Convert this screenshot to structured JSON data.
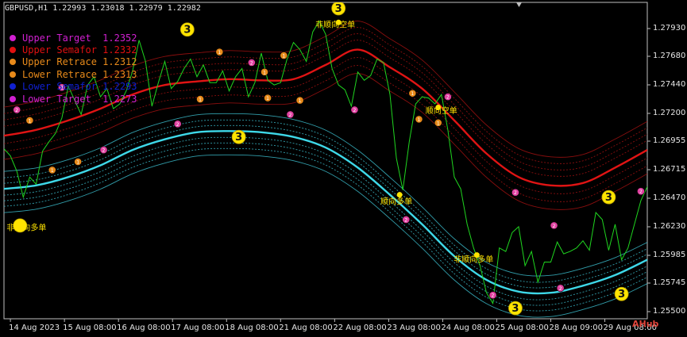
{
  "header": {
    "symbol": "GBPUSD,H1  1.22993 1.23018 1.22979 1.22982"
  },
  "legend": [
    {
      "label": "Upper Target  1.2352",
      "color": "#d020d0"
    },
    {
      "label": "Upper Semafor 1.2332",
      "color": "#e01010"
    },
    {
      "label": "Upper Retrace 1.2312",
      "color": "#e88a1a"
    },
    {
      "label": "Lower Retrace 1.2313",
      "color": "#e88a1a"
    },
    {
      "label": "Lower Semafor 1.2293",
      "color": "#1020d0"
    },
    {
      "label": "Lower Target  1.2273",
      "color": "#d020d0"
    }
  ],
  "watermark": "AHub",
  "chart_data": {
    "type": "line",
    "ylim": [
      1.254,
      1.2808
    ],
    "xlim": [
      0,
      100
    ],
    "y_ticks": [
      "1.27930",
      "1.27680",
      "1.27440",
      "1.27200",
      "1.26955",
      "1.26715",
      "1.26470",
      "1.26230",
      "1.25985",
      "1.25745",
      "1.25500"
    ],
    "x_ticks": [
      {
        "label": "14 Aug 2023",
        "x": 1
      },
      {
        "label": "15 Aug 08:00",
        "x": 9.4
      },
      {
        "label": "16 Aug 08:00",
        "x": 17.8
      },
      {
        "label": "17 Aug 08:00",
        "x": 26.2
      },
      {
        "label": "18 Aug 08:00",
        "x": 34.6
      },
      {
        "label": "21 Aug 08:00",
        "x": 43
      },
      {
        "label": "22 Aug 08:00",
        "x": 51.4
      },
      {
        "label": "23 Aug 08:00",
        "x": 59.8
      },
      {
        "label": "24 Aug 08:00",
        "x": 68.2
      },
      {
        "label": "25 Aug 08:00",
        "x": 76.6
      },
      {
        "label": "28 Aug 09:00",
        "x": 85
      },
      {
        "label": "29 Aug 08:00",
        "x": 93.4
      }
    ],
    "series": [
      {
        "key": "upper",
        "color": "#e01414",
        "x": [
          0,
          5,
          10,
          15,
          20,
          25,
          30,
          35,
          40,
          45,
          50,
          55,
          60,
          65,
          70,
          75,
          80,
          85,
          90,
          95,
          100
        ],
        "y": [
          1.2695,
          1.27,
          1.2708,
          1.2718,
          1.273,
          1.2738,
          1.2741,
          1.2743,
          1.2742,
          1.2743,
          1.2755,
          1.2768,
          1.2753,
          1.2735,
          1.2708,
          1.268,
          1.266,
          1.2653,
          1.2655,
          1.2668,
          1.2683
        ]
      },
      {
        "key": "lower",
        "color": "#3ed8e8",
        "x": [
          0,
          5,
          10,
          15,
          20,
          25,
          30,
          35,
          40,
          45,
          50,
          55,
          60,
          65,
          70,
          75,
          80,
          85,
          90,
          95,
          100
        ],
        "y": [
          1.265,
          1.2653,
          1.266,
          1.267,
          1.2683,
          1.2692,
          1.2698,
          1.2699,
          1.2698,
          1.2694,
          1.2685,
          1.2668,
          1.2645,
          1.262,
          1.2593,
          1.2573,
          1.2563,
          1.2562,
          1.2568,
          1.2577,
          1.259
        ]
      },
      {
        "key": "price",
        "color": "#1fd51f",
        "x": [
          0,
          1,
          2,
          3,
          4,
          5,
          6,
          7,
          8,
          9,
          10,
          11,
          12,
          13,
          14,
          15,
          16,
          17,
          18,
          19,
          20,
          21,
          22,
          23,
          24,
          25,
          26,
          27,
          28,
          29,
          30,
          31,
          32,
          33,
          34,
          35,
          36,
          37,
          38,
          39,
          40,
          41,
          42,
          43,
          44,
          45,
          46,
          47,
          48,
          49,
          50,
          51,
          52,
          53,
          54,
          55,
          56,
          57,
          58,
          59,
          60,
          61,
          62,
          63,
          64,
          65,
          66,
          67,
          68,
          69,
          70,
          71,
          72,
          73,
          74,
          75,
          76,
          77,
          78,
          79,
          80,
          81,
          82,
          83,
          84,
          85,
          86,
          87,
          88,
          89,
          90,
          91,
          92,
          93,
          94,
          95,
          96,
          97,
          98,
          99,
          100
        ],
        "y": [
          1.2684,
          1.2678,
          1.2665,
          1.2643,
          1.266,
          1.2654,
          1.2682,
          1.269,
          1.2697,
          1.271,
          1.2737,
          1.2725,
          1.2713,
          1.2738,
          1.2745,
          1.2728,
          1.2735,
          1.2718,
          1.2722,
          1.2733,
          1.275,
          1.2776,
          1.2758,
          1.272,
          1.274,
          1.2758,
          1.2735,
          1.2741,
          1.2752,
          1.276,
          1.2745,
          1.2755,
          1.274,
          1.274,
          1.275,
          1.2733,
          1.2745,
          1.2752,
          1.2728,
          1.274,
          1.2765,
          1.2742,
          1.2738,
          1.274,
          1.276,
          1.2774,
          1.2768,
          1.2758,
          1.2783,
          1.2792,
          1.2781,
          1.2752,
          1.2738,
          1.2734,
          1.272,
          1.2749,
          1.2742,
          1.2746,
          1.276,
          1.2757,
          1.273,
          1.2676,
          1.2649,
          1.269,
          1.2722,
          1.2728,
          1.2727,
          1.2722,
          1.273,
          1.27,
          1.266,
          1.265,
          1.262,
          1.26,
          1.2585,
          1.2562,
          1.2553,
          1.26,
          1.2597,
          1.2613,
          1.2618,
          1.2585,
          1.2597,
          1.2571,
          1.2588,
          1.2588,
          1.2605,
          1.2595,
          1.2597,
          1.26,
          1.2606,
          1.2598,
          1.263,
          1.2624,
          1.2598,
          1.262,
          1.259,
          1.26,
          1.262,
          1.264,
          1.2652
        ]
      }
    ],
    "markers": [
      {
        "x": 2,
        "y": 1.2717,
        "color": "#e040a0"
      },
      {
        "x": 4,
        "y": 1.2708,
        "color": "#e88a1a"
      },
      {
        "x": 7.5,
        "y": 1.2666,
        "color": "#e88a1a"
      },
      {
        "x": 9,
        "y": 1.2736,
        "color": "#e040a0"
      },
      {
        "x": 11.5,
        "y": 1.2673,
        "color": "#e88a1a"
      },
      {
        "x": 15.5,
        "y": 1.2683,
        "color": "#e040a0"
      },
      {
        "x": 27,
        "y": 1.2705,
        "color": "#e040a0"
      },
      {
        "x": 30.5,
        "y": 1.2726,
        "color": "#e88a1a"
      },
      {
        "x": 33.5,
        "y": 1.2766,
        "color": "#e88a1a"
      },
      {
        "x": 38.5,
        "y": 1.2757,
        "color": "#e040a0"
      },
      {
        "x": 40.5,
        "y": 1.2749,
        "color": "#e88a1a"
      },
      {
        "x": 41,
        "y": 1.2727,
        "color": "#e88a1a"
      },
      {
        "x": 43.5,
        "y": 1.2763,
        "color": "#e88a1a"
      },
      {
        "x": 44.5,
        "y": 1.2713,
        "color": "#e040a0"
      },
      {
        "x": 46,
        "y": 1.2725,
        "color": "#e88a1a"
      },
      {
        "x": 54.5,
        "y": 1.2717,
        "color": "#e040a0"
      },
      {
        "x": 63.5,
        "y": 1.2731,
        "color": "#e88a1a"
      },
      {
        "x": 64.5,
        "y": 1.2709,
        "color": "#e88a1a"
      },
      {
        "x": 67.5,
        "y": 1.2706,
        "color": "#e88a1a"
      },
      {
        "x": 69,
        "y": 1.2728,
        "color": "#e040a0"
      },
      {
        "x": 62.5,
        "y": 1.2624,
        "color": "#e040a0"
      },
      {
        "x": 79.5,
        "y": 1.2647,
        "color": "#e040a0"
      },
      {
        "x": 76,
        "y": 1.256,
        "color": "#e040a0"
      },
      {
        "x": 85.5,
        "y": 1.2619,
        "color": "#e040a0"
      },
      {
        "x": 86.5,
        "y": 1.2566,
        "color": "#e040a0"
      },
      {
        "x": 99,
        "y": 1.2648,
        "color": "#e040a0"
      }
    ],
    "semafors": [
      {
        "x": 28.5,
        "y": 1.2785,
        "label": "3"
      },
      {
        "x": 52,
        "y": 1.2803,
        "label": "3"
      },
      {
        "x": 36.5,
        "y": 1.2694,
        "label": "3"
      },
      {
        "x": 94,
        "y": 1.2643,
        "label": "3"
      },
      {
        "x": 79.5,
        "y": 1.2549,
        "label": "3"
      },
      {
        "x": 96,
        "y": 1.2561,
        "label": "3"
      },
      {
        "x": 2.5,
        "y": 1.2619,
        "label": ""
      }
    ],
    "signals": [
      {
        "x": 52,
        "y": 1.2791,
        "text": "非顺向空单",
        "arrow": "down",
        "tx": 51.5,
        "ty": 1.2789
      },
      {
        "x": 67.5,
        "y": 1.2719,
        "text": "顺向空单",
        "arrow": "down",
        "tx": 68,
        "ty": 1.2716
      },
      {
        "x": 61.5,
        "y": 1.2645,
        "text": "顺向多单",
        "arrow": "up",
        "tx": 61,
        "ty": 1.2639
      },
      {
        "x": 73.5,
        "y": 1.2594,
        "text": "非顺向多单",
        "arrow": "up",
        "tx": 73,
        "ty": 1.259
      },
      {
        "x": 3,
        "y": 1.2619,
        "text": "非顺向多单",
        "arrow": "up",
        "tx": 3.5,
        "ty": 1.2617
      }
    ]
  }
}
